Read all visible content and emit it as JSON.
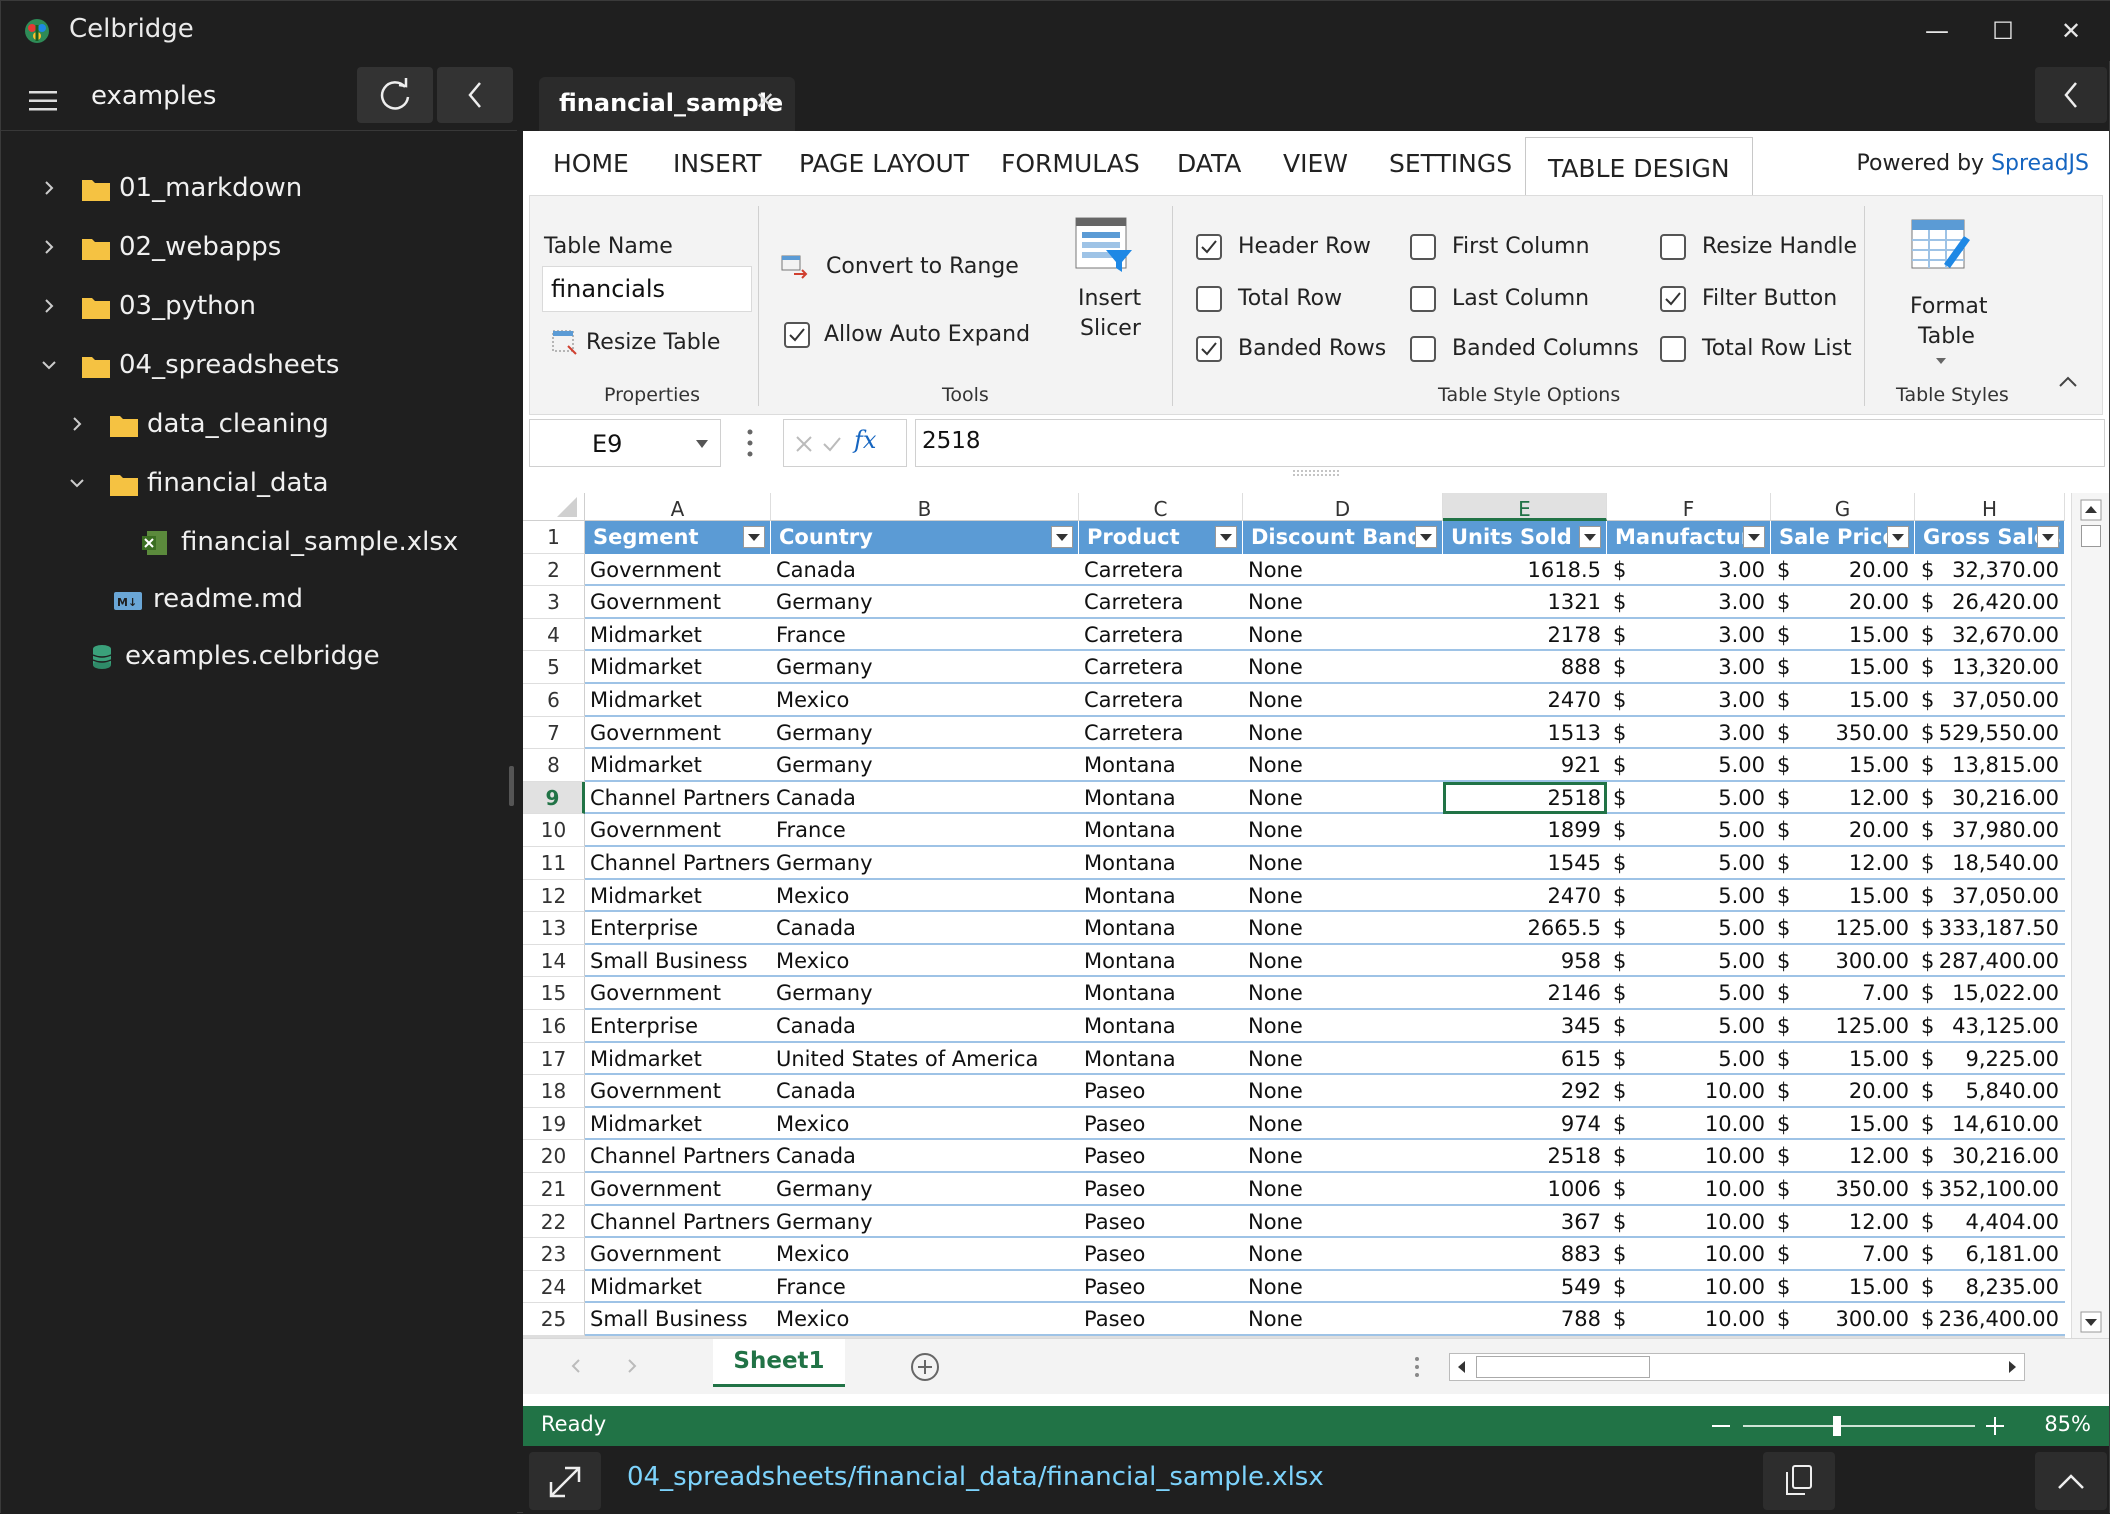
{
  "app": {
    "title": "Celbridge"
  },
  "window_controls": {
    "minimize": "—",
    "maximize": "☐",
    "close": "✕"
  },
  "sidebar": {
    "title": "examples",
    "items": [
      {
        "label": "01_markdown"
      },
      {
        "label": "02_webapps"
      },
      {
        "label": "03_python"
      },
      {
        "label": "04_spreadsheets"
      },
      {
        "label": "data_cleaning"
      },
      {
        "label": "financial_data"
      },
      {
        "label": "financial_sample.xlsx"
      },
      {
        "label": "readme.md"
      },
      {
        "label": "examples.celbridge"
      }
    ]
  },
  "editor": {
    "tab_label": "financial_sample",
    "tab_close": "✕"
  },
  "ribbon": {
    "tabs": [
      "HOME",
      "INSERT",
      "PAGE LAYOUT",
      "FORMULAS",
      "DATA",
      "VIEW",
      "SETTINGS",
      "TABLE DESIGN"
    ],
    "powered_prefix": "Powered by ",
    "powered_brand": "SpreadJS",
    "table_name_label": "Table Name",
    "table_name_value": "financials",
    "resize_table": "Resize Table",
    "properties_label": "Properties",
    "convert_to_range": "Convert to Range",
    "allow_auto_expand": "Allow Auto Expand",
    "insert_slicer_1": "Insert",
    "insert_slicer_2": "Slicer",
    "tools_label": "Tools",
    "options": {
      "header_row": "Header Row",
      "total_row": "Total Row",
      "banded_rows": "Banded Rows",
      "first_column": "First Column",
      "last_column": "Last Column",
      "banded_columns": "Banded Columns",
      "resize_handle": "Resize Handle",
      "filter_button": "Filter Button",
      "total_row_list": "Total Row List"
    },
    "options_label": "Table Style Options",
    "format_table_1": "Format",
    "format_table_2": "Table",
    "styles_label": "Table Styles"
  },
  "formula_bar": {
    "cell_ref": "E9",
    "value": "2518",
    "fx": "fx"
  },
  "grid": {
    "columns": [
      "A",
      "B",
      "C",
      "D",
      "E",
      "F",
      "G",
      "H"
    ],
    "headers": [
      "Segment",
      "Country",
      "Product",
      "Discount Band",
      "Units Sold",
      "Manufacturi",
      "Sale Price",
      "Gross Sales"
    ],
    "row_numbers": [
      "1",
      "2",
      "3",
      "4",
      "5",
      "6",
      "7",
      "8",
      "9",
      "10",
      "11",
      "12",
      "13",
      "14",
      "15",
      "16",
      "17",
      "18",
      "19",
      "20",
      "21",
      "22",
      "23",
      "24",
      "25"
    ],
    "currency": "$",
    "rows": [
      [
        "Government",
        "Canada",
        "Carretera",
        "None",
        "1618.5",
        "3.00",
        "20.00",
        "32,370.00"
      ],
      [
        "Government",
        "Germany",
        "Carretera",
        "None",
        "1321",
        "3.00",
        "20.00",
        "26,420.00"
      ],
      [
        "Midmarket",
        "France",
        "Carretera",
        "None",
        "2178",
        "3.00",
        "15.00",
        "32,670.00"
      ],
      [
        "Midmarket",
        "Germany",
        "Carretera",
        "None",
        "888",
        "3.00",
        "15.00",
        "13,320.00"
      ],
      [
        "Midmarket",
        "Mexico",
        "Carretera",
        "None",
        "2470",
        "3.00",
        "15.00",
        "37,050.00"
      ],
      [
        "Government",
        "Germany",
        "Carretera",
        "None",
        "1513",
        "3.00",
        "350.00",
        "529,550.00"
      ],
      [
        "Midmarket",
        "Germany",
        "Montana",
        "None",
        "921",
        "5.00",
        "15.00",
        "13,815.00"
      ],
      [
        "Channel Partners",
        "Canada",
        "Montana",
        "None",
        "2518",
        "5.00",
        "12.00",
        "30,216.00"
      ],
      [
        "Government",
        "France",
        "Montana",
        "None",
        "1899",
        "5.00",
        "20.00",
        "37,980.00"
      ],
      [
        "Channel Partners",
        "Germany",
        "Montana",
        "None",
        "1545",
        "5.00",
        "12.00",
        "18,540.00"
      ],
      [
        "Midmarket",
        "Mexico",
        "Montana",
        "None",
        "2470",
        "5.00",
        "15.00",
        "37,050.00"
      ],
      [
        "Enterprise",
        "Canada",
        "Montana",
        "None",
        "2665.5",
        "5.00",
        "125.00",
        "333,187.50"
      ],
      [
        "Small Business",
        "Mexico",
        "Montana",
        "None",
        "958",
        "5.00",
        "300.00",
        "287,400.00"
      ],
      [
        "Government",
        "Germany",
        "Montana",
        "None",
        "2146",
        "5.00",
        "7.00",
        "15,022.00"
      ],
      [
        "Enterprise",
        "Canada",
        "Montana",
        "None",
        "345",
        "5.00",
        "125.00",
        "43,125.00"
      ],
      [
        "Midmarket",
        "United States of America",
        "Montana",
        "None",
        "615",
        "5.00",
        "15.00",
        "9,225.00"
      ],
      [
        "Government",
        "Canada",
        "Paseo",
        "None",
        "292",
        "10.00",
        "20.00",
        "5,840.00"
      ],
      [
        "Midmarket",
        "Mexico",
        "Paseo",
        "None",
        "974",
        "10.00",
        "15.00",
        "14,610.00"
      ],
      [
        "Channel Partners",
        "Canada",
        "Paseo",
        "None",
        "2518",
        "10.00",
        "12.00",
        "30,216.00"
      ],
      [
        "Government",
        "Germany",
        "Paseo",
        "None",
        "1006",
        "10.00",
        "350.00",
        "352,100.00"
      ],
      [
        "Channel Partners",
        "Germany",
        "Paseo",
        "None",
        "367",
        "10.00",
        "12.00",
        "4,404.00"
      ],
      [
        "Government",
        "Mexico",
        "Paseo",
        "None",
        "883",
        "10.00",
        "7.00",
        "6,181.00"
      ],
      [
        "Midmarket",
        "France",
        "Paseo",
        "None",
        "549",
        "10.00",
        "15.00",
        "8,235.00"
      ],
      [
        "Small Business",
        "Mexico",
        "Paseo",
        "None",
        "788",
        "10.00",
        "300.00",
        "236,400.00"
      ]
    ]
  },
  "sheet": {
    "tab": "Sheet1"
  },
  "status": {
    "text": "Ready",
    "zoom": "85%"
  },
  "footer": {
    "path": "04_spreadsheets/financial_data/financial_sample.xlsx"
  },
  "colors": {
    "accent_green": "#217346",
    "table_header": "#5b9bd5",
    "link": "#7dd3fc"
  }
}
